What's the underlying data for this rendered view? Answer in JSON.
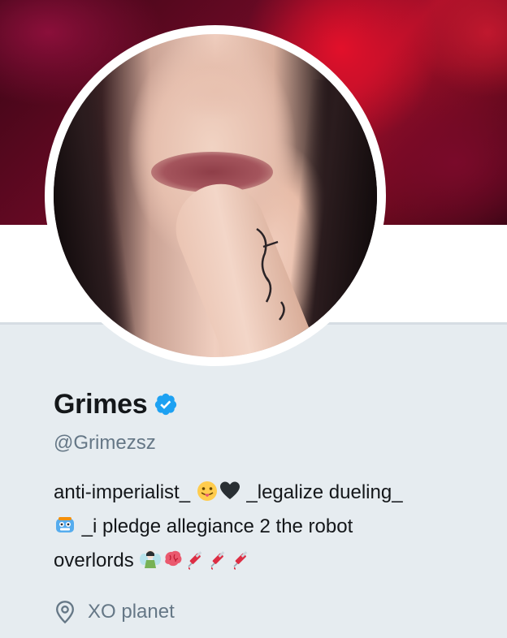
{
  "profile": {
    "name": "Grimes",
    "handle": "@Grimezsz",
    "bio": {
      "part1": "anti-imperialist_ ",
      "part2": " _legalize dueling_",
      "part3": " _i pledge allegiance 2 the robot",
      "part4": "overlords "
    },
    "location": "XO planet",
    "verified": true
  },
  "icons": {
    "verified": "verified-badge-icon",
    "location": "location-pin-icon",
    "emoji": [
      "tongue-face-emoji",
      "black-heart-emoji",
      "robot-emoji",
      "fairy-emoji",
      "brain-emoji",
      "syringe-emoji",
      "syringe-emoji",
      "syringe-emoji"
    ]
  },
  "colors": {
    "verified": "#1da1f2",
    "text": "#14171a",
    "secondary": "#657786",
    "background": "#e6ecf0"
  }
}
